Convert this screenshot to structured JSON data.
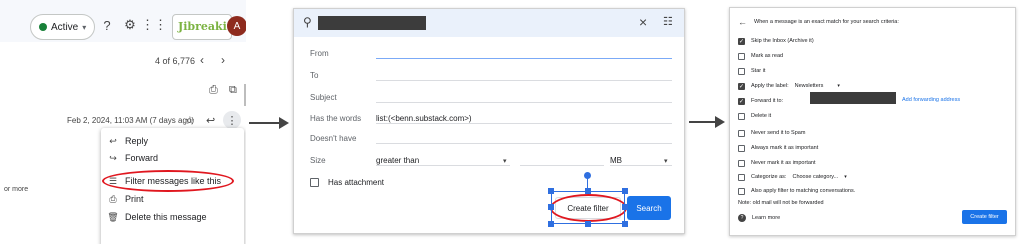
{
  "panel1": {
    "status_label": "Active",
    "help_icon": "help-circle-icon",
    "settings_icon": "gear-icon",
    "apps_icon": "apps-grid-icon",
    "brand_text": "Jibreakits",
    "avatar_letter": "A",
    "pagination": "4 of 6,776",
    "date": "Feb 2, 2024, 11:03 AM (7 days ago)",
    "side_text": "or more",
    "menu": [
      {
        "icon": "reply-icon",
        "label": "Reply"
      },
      {
        "icon": "forward-icon",
        "label": "Forward"
      },
      {
        "icon": "filter-icon",
        "label": "Filter messages like this"
      },
      {
        "icon": "print-icon",
        "label": "Print"
      },
      {
        "icon": "trash-icon",
        "label": "Delete this message"
      }
    ]
  },
  "panel2": {
    "fields": {
      "from_label": "From",
      "to_label": "To",
      "subject_label": "Subject",
      "has_words_label": "Has the words",
      "has_words_value": "list:(<benn.substack.com>)",
      "doesnt_have_label": "Doesn't have",
      "size_label": "Size",
      "size_operator": "greater than",
      "size_unit": "MB",
      "has_attachment_label": "Has attachment"
    },
    "create_filter_label": "Create filter",
    "search_label": "Search"
  },
  "panel3": {
    "header": "When a message is an exact match for your search criteria:",
    "options": [
      {
        "label": "Skip the Inbox (Archive it)",
        "checked": true
      },
      {
        "label": "Mark as read",
        "checked": false
      },
      {
        "label": "Star it",
        "checked": false
      },
      {
        "label": "Apply the label:",
        "checked": true,
        "value": "Newsletters"
      },
      {
        "label": "Forward it to:",
        "checked": true
      },
      {
        "label": "Delete it",
        "checked": false
      },
      {
        "label": "Never send it to Spam",
        "checked": false
      },
      {
        "label": "Always mark it as important",
        "checked": false
      },
      {
        "label": "Never mark it as important",
        "checked": false
      },
      {
        "label": "Categorize as:",
        "checked": false,
        "value": "Choose category..."
      },
      {
        "label": "Also apply filter to matching conversations.",
        "checked": false
      }
    ],
    "forwarding_link": "Add forwarding address",
    "note": "Note: old mail will not be forwarded",
    "learn_more": "Learn more",
    "create_filter_label": "Create filter"
  }
}
